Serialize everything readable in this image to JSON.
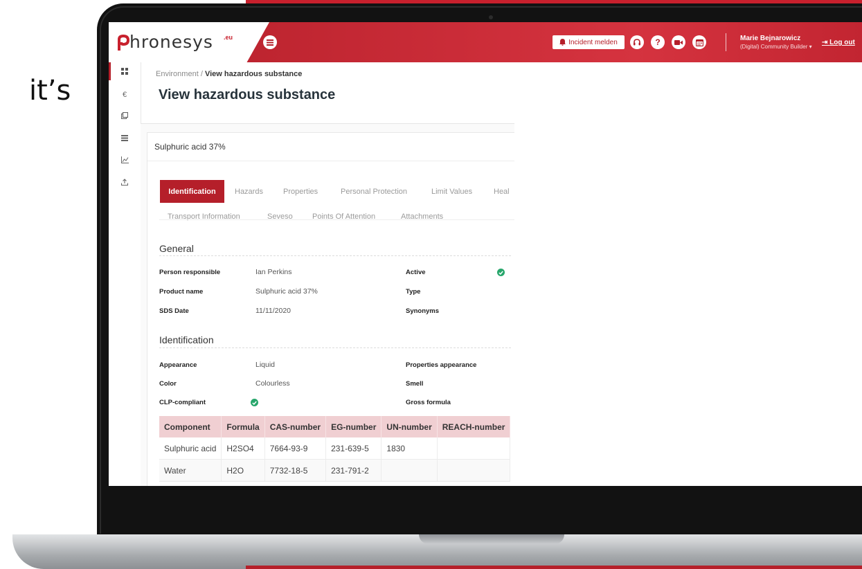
{
  "caption": "it’s",
  "brand": {
    "logo_text": "hronesys",
    "logo_sup": ".eu",
    "accent": "#b51f2a",
    "success": "#27a66b"
  },
  "header": {
    "incident_label": "Incident melden",
    "icons": [
      "headset-icon",
      "help-icon",
      "video-icon",
      "calendar-icon"
    ],
    "user_name": "Marie Bejnarowicz",
    "user_role": "(Digital) Community Builder",
    "logout_label": "Log out"
  },
  "sidebar": {
    "icons": [
      "dashboard-icon",
      "euro-icon",
      "copy-icon",
      "list-icon",
      "chart-icon",
      "upload-icon"
    ]
  },
  "breadcrumb": {
    "parent": "Environment",
    "separator": "/",
    "current": "View hazardous substance"
  },
  "page_title": "View hazardous substance",
  "card_title": "Sulphuric acid 37%",
  "tabs": {
    "active": "Identification",
    "row1": [
      "Hazards",
      "Properties",
      "Personal Protection",
      "Limit Values",
      "Heal"
    ],
    "row2": [
      "Transport Information",
      "Seveso",
      "Points Of Attention",
      "Attachments"
    ]
  },
  "general": {
    "title": "General",
    "person_label": "Person responsible",
    "person_value": "Ian Perkins",
    "product_label": "Product name",
    "product_value": "Sulphuric acid 37%",
    "sds_label": "SDS Date",
    "sds_value": "11/11/2020",
    "active_label": "Active",
    "active_value": true,
    "type_label": "Type",
    "synonyms_label": "Synonyms"
  },
  "identification": {
    "title": "Identification",
    "appearance_label": "Appearance",
    "appearance_value": "Liquid",
    "color_label": "Color",
    "color_value": "Colourless",
    "clp_label": "CLP-compliant",
    "clp_value": true,
    "prop_appearance_label": "Properties appearance",
    "smell_label": "Smell",
    "gross_formula_label": "Gross formula"
  },
  "components": {
    "headers": [
      "Component",
      "Formula",
      "CAS-number",
      "EG-number",
      "UN-number",
      "REACH-number"
    ],
    "rows": [
      [
        "Sulphuric acid",
        "H2SO4",
        "7664-93-9",
        "231-639-5",
        "1830",
        ""
      ],
      [
        "Water",
        "H2O",
        "7732-18-5",
        "231-791-2",
        "",
        ""
      ]
    ]
  }
}
